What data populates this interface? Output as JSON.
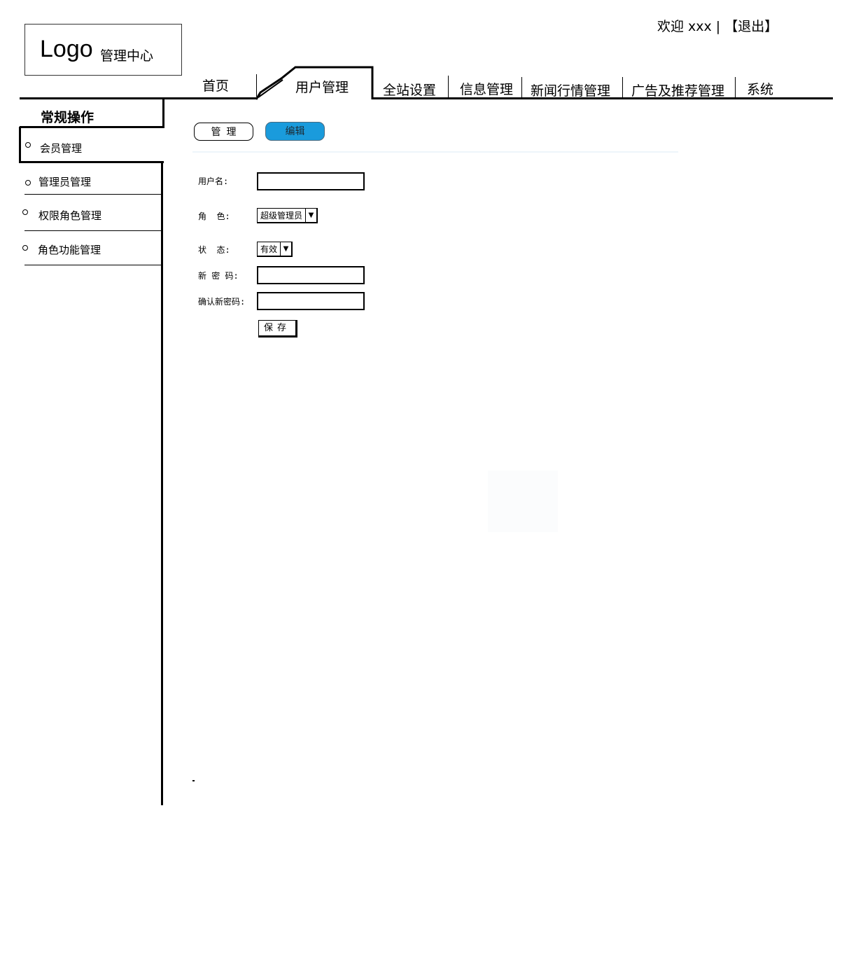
{
  "header": {
    "logo_text": "Logo",
    "logo_subtitle": "管理中心",
    "welcome_text": "欢迎 xxx",
    "separator": "|",
    "logout_label": "【退出】"
  },
  "nav": {
    "tabs": [
      {
        "label": "首页"
      },
      {
        "label": "用户管理",
        "active": true
      },
      {
        "label": "全站设置"
      },
      {
        "label": "信息管理"
      },
      {
        "label": "新闻行情管理"
      },
      {
        "label": "广告及推荐管理"
      },
      {
        "label": "系统"
      }
    ]
  },
  "sidebar": {
    "title": "常规操作",
    "items": [
      {
        "label": "会员管理",
        "active": true
      },
      {
        "label": "管理员管理"
      },
      {
        "label": "权限角色管理"
      },
      {
        "label": "角色功能管理"
      }
    ]
  },
  "toolbar": {
    "manage_label": "管理",
    "edit_label": "编辑",
    "edit_color": "#1a9bdc"
  },
  "form": {
    "username_label": "用户名:",
    "username_value": "",
    "role_label": "角  色:",
    "role_value": "超级管理员",
    "status_label": "状  态:",
    "status_value": "有效",
    "new_password_label": "新 密 码:",
    "new_password_value": "",
    "confirm_password_label": "确认新密码:",
    "confirm_password_value": "",
    "save_label": "保存"
  }
}
